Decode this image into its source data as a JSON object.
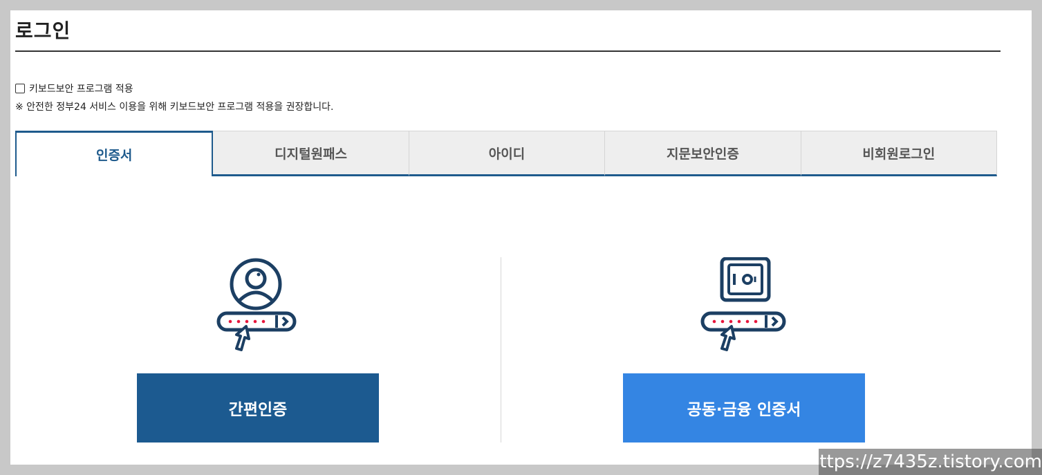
{
  "page": {
    "title": "로그인"
  },
  "keyboard_security": {
    "checkbox_label": "키보드보안 프로그램 적용",
    "checked": false,
    "notice": "※ 안전한 정부24 서비스 이용을 위해 키보드보안 프로그램 적용을 권장합니다."
  },
  "tabs": [
    {
      "label": "인증서",
      "active": true
    },
    {
      "label": "디지털원패스",
      "active": false
    },
    {
      "label": "아이디",
      "active": false
    },
    {
      "label": "지문보안인증",
      "active": false
    },
    {
      "label": "비회원로그인",
      "active": false
    }
  ],
  "options": {
    "simple_auth": {
      "label": "간편인증",
      "icon": "person-certificate-icon"
    },
    "joint_cert": {
      "label": "공동·금융 인증서",
      "icon": "safe-certificate-icon"
    }
  },
  "colors": {
    "primary": "#1c5a90",
    "accent": "#3485e3",
    "dots": "#e8163c"
  },
  "watermark": "https://z7435z.tistory.com"
}
